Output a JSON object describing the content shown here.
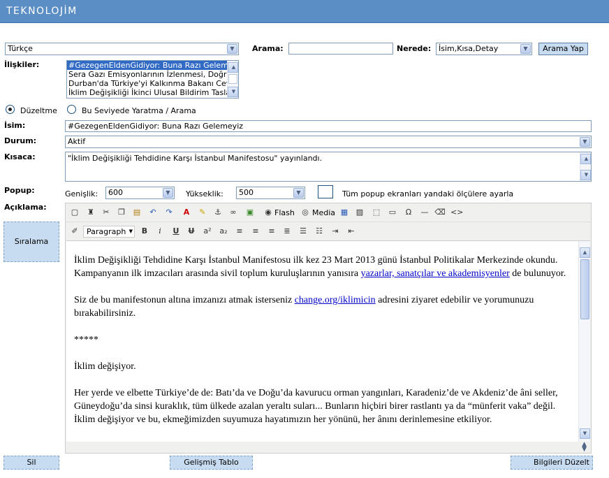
{
  "header": {
    "logo": "TEKNOLOJİM"
  },
  "language": {
    "selected": "Türkçe"
  },
  "search": {
    "label": "Arama:",
    "value": "",
    "where_label": "Nerede:",
    "where_selected": "İsim,Kısa,Detay",
    "button": "Arama Yap"
  },
  "relations": {
    "label": "İlişkiler:",
    "items": [
      "#GezegenEldenGidiyor: Buna Razı Gelemeyiz",
      "Sera Gazı Emisyonlarının İzlenmesi, Doğrulanması",
      "Durban'da Türkiye'yi Kalkınma Bakanı Cevdet Yılmaz",
      "İklim Değişikliği İkinci Ulusal Bildirim Taslağı"
    ]
  },
  "mode": {
    "edit_label": "Düzeltme",
    "create_label": "Bu Seviyede Yaratma / Arama"
  },
  "name": {
    "label": "İsim:",
    "value": "#GezegenEldenGidiyor: Buna Razı Gelemeyiz"
  },
  "status": {
    "label": "Durum:",
    "selected": "Aktif"
  },
  "short": {
    "label": "Kısaca:",
    "value": "\"İklim Değişikliği Tehdidine Karşı İstanbul Manifestosu\" yayınlandı."
  },
  "popup": {
    "label": "Popup:",
    "width_label": "Genişlik:",
    "width_value": "600",
    "height_label": "Yükseklik:",
    "height_value": "500",
    "apply_all_label": "Tüm popup ekranları yandaki ölçülere ayarla"
  },
  "description": {
    "label": "Açıklama:"
  },
  "sort_button": "Sıralama",
  "editor": {
    "flash_label": "Flash",
    "media_label": "Media",
    "format_selected": "Paragraph",
    "p1_a": "İklim Değişikliği Tehdidine Karşı İstanbul Manifestosu ilk kez 23 Mart 2013 günü İstanbul Politikalar Merkezinde okundu. Kampanyanın ilk imzacıları arasında sivil toplum kuruluşlarının yanısıra ",
    "p1_link": "yazarlar, sanatçılar ve akademisyenler",
    "p1_b": " de bulunuyor.",
    "p2_a": "Siz de bu manifestonun altına imzanızı atmak isterseniz ",
    "p2_link": "change.org/iklimicin",
    "p2_b": " adresini ziyaret edebilir ve yorumunuzu bırakabilirsiniz.",
    "p3": "*****",
    "p4": "İklim değişiyor.",
    "p5": "Her yerde ve elbette Türkiye’de de: Batı’da ve Doğu’da kavurucu orman yangınları, Karadeniz’de ve Akdeniz’de âni seller, Güneydoğu’da sinsi kuraklık, tüm ülkede azalan yeraltı suları... Bunların hiçbiri birer rastlantı ya da “münferit vaka” değil. İklim değişiyor ve bu, ekmeğimizden suyumuza hayatımızın her yönünü, her ânını derinlemesine etkiliyor."
  },
  "footer": {
    "delete": "Sil",
    "advanced_table": "Gelişmiş Tablo",
    "save": "Bilgileri Düzelt"
  }
}
